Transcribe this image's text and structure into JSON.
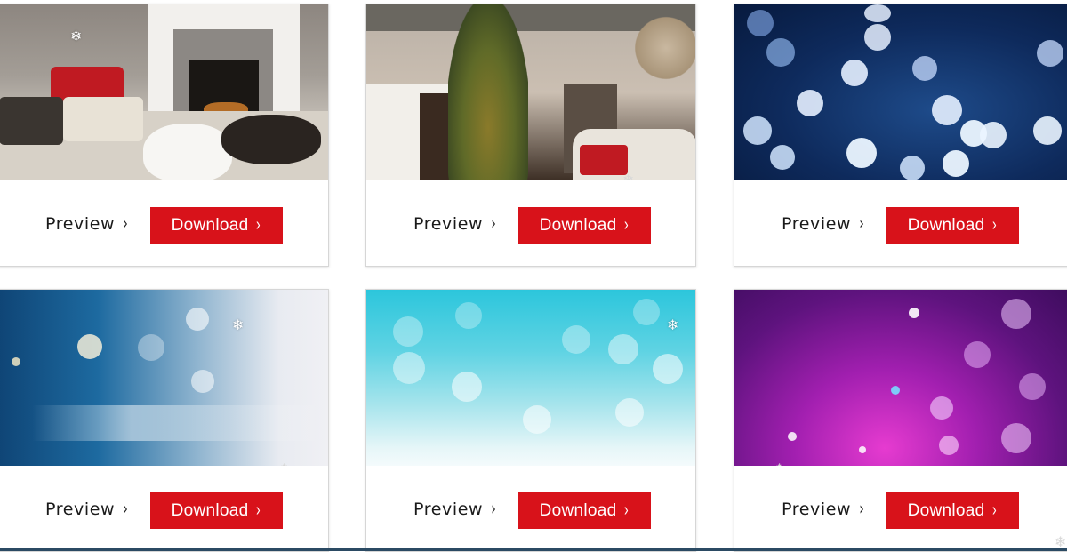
{
  "cards": [
    {
      "name": "living-room-cats",
      "image_alt": "Living room with fireplace, pillows and two cats",
      "preview_label": "Preview",
      "download_label": "Download",
      "preview_chevron": "›",
      "download_chevron": "›"
    },
    {
      "name": "christmas-tree-staircase",
      "image_alt": "Decorated Christmas tree beside staircase",
      "preview_label": "Preview",
      "download_label": "Download",
      "preview_chevron": "›",
      "download_chevron": "›"
    },
    {
      "name": "blue-bokeh",
      "image_alt": "Dark blue bokeh lights",
      "preview_label": "Preview",
      "download_label": "Download",
      "preview_chevron": "›",
      "download_chevron": "›"
    },
    {
      "name": "blue-white-light",
      "image_alt": "Blue and white light flare background",
      "preview_label": "Preview",
      "download_label": "Download",
      "preview_chevron": "›",
      "download_chevron": "›"
    },
    {
      "name": "aqua-bokeh",
      "image_alt": "Aqua turquoise bokeh background",
      "preview_label": "Preview",
      "download_label": "Download",
      "preview_chevron": "›",
      "download_chevron": "›"
    },
    {
      "name": "purple-sparkle",
      "image_alt": "Purple and magenta sparkle bokeh",
      "preview_label": "Preview",
      "download_label": "Download",
      "preview_chevron": "›",
      "download_chevron": "›"
    }
  ],
  "snowflake_glyph": "❄",
  "colors": {
    "download_button": "#d8121a",
    "text": "#1a1a1a"
  }
}
